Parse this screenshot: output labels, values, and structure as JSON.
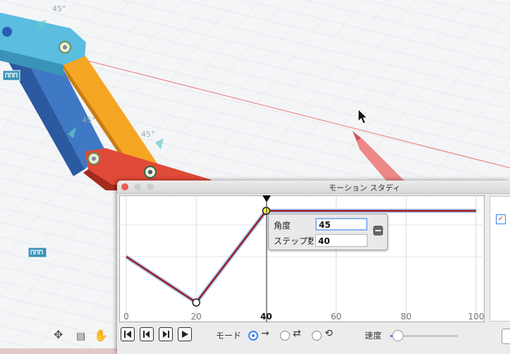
{
  "viewport": {
    "angle_labels": [
      "45°",
      "45°",
      "45°"
    ]
  },
  "panel": {
    "title": "モーション スタディ",
    "axis_ticks": [
      "0",
      "20",
      "40",
      "60",
      "80",
      "100"
    ],
    "popup": {
      "angle_label": "角度",
      "angle_value": "45",
      "step_label": "ステップ数",
      "step_value": "40"
    },
    "mode_label": "モード",
    "speed_label": "速度",
    "mode_selected": "one-way"
  },
  "chart_data": {
    "type": "line",
    "x": [
      0,
      20,
      40,
      100
    ],
    "y": [
      0,
      -45,
      45,
      45
    ],
    "xlabel": "",
    "ylabel": "",
    "xticks": [
      "0",
      "20",
      "40",
      "60",
      "80",
      "100"
    ],
    "xlim": [
      0,
      100
    ]
  }
}
